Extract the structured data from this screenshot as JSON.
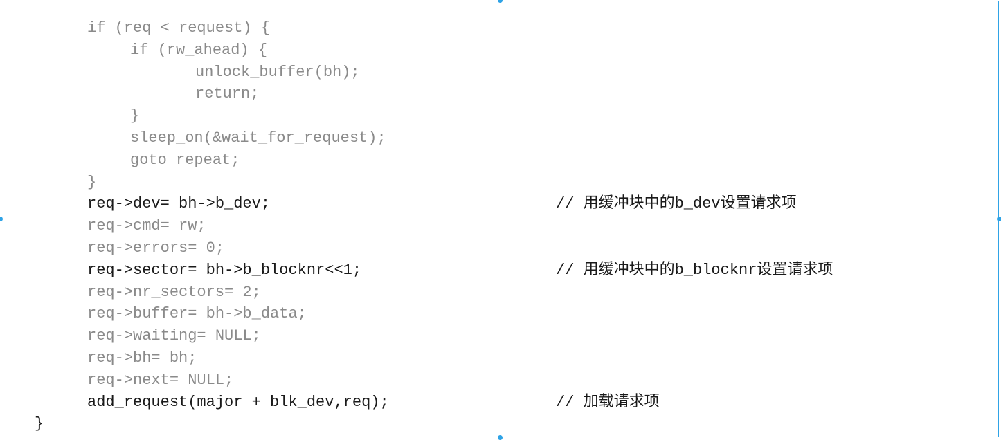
{
  "colors": {
    "border": "#2fa3e6",
    "code_dim": "#8a8a8a",
    "code_dark": "#1a1a1a"
  },
  "code_lines": [
    {
      "text": "if (req < request) {",
      "indent": 1,
      "tone": "dim",
      "comment": ""
    },
    {
      "text": "if (rw_ahead) {",
      "indent": 2,
      "tone": "dim",
      "comment": ""
    },
    {
      "text": "unlock_buffer(bh);",
      "indent": 3,
      "tone": "dim",
      "comment": ""
    },
    {
      "text": "return;",
      "indent": 3,
      "tone": "dim",
      "comment": ""
    },
    {
      "text": "}",
      "indent": 2,
      "tone": "dim",
      "comment": ""
    },
    {
      "text": "sleep_on(&wait_for_request);",
      "indent": 2,
      "tone": "dim",
      "comment": ""
    },
    {
      "text": "goto repeat;",
      "indent": 2,
      "tone": "dim",
      "comment": ""
    },
    {
      "text": "}",
      "indent": 1,
      "tone": "dim",
      "comment": ""
    },
    {
      "text": "req->dev= bh->b_dev;",
      "indent": 1,
      "tone": "dark",
      "comment": "// 用缓冲块中的b_dev设置请求项"
    },
    {
      "text": "req->cmd= rw;",
      "indent": 1,
      "tone": "dim",
      "comment": ""
    },
    {
      "text": "req->errors= 0;",
      "indent": 1,
      "tone": "dim",
      "comment": ""
    },
    {
      "text": "req->sector= bh->b_blocknr<<1;",
      "indent": 1,
      "tone": "dark",
      "comment": "// 用缓冲块中的b_blocknr设置请求项"
    },
    {
      "text": "req->nr_sectors= 2;",
      "indent": 1,
      "tone": "dim",
      "comment": ""
    },
    {
      "text": "req->buffer= bh->b_data;",
      "indent": 1,
      "tone": "dim",
      "comment": ""
    },
    {
      "text": "req->waiting= NULL;",
      "indent": 1,
      "tone": "dim",
      "comment": ""
    },
    {
      "text": "req->bh= bh;",
      "indent": 1,
      "tone": "dim",
      "comment": ""
    },
    {
      "text": "req->next= NULL;",
      "indent": 1,
      "tone": "dim",
      "comment": ""
    },
    {
      "text": "add_request(major + blk_dev,req);",
      "indent": 1,
      "tone": "dark",
      "comment": "// 加载请求项"
    },
    {
      "text": "}",
      "indent": 0,
      "tone": "dark",
      "comment": ""
    }
  ]
}
